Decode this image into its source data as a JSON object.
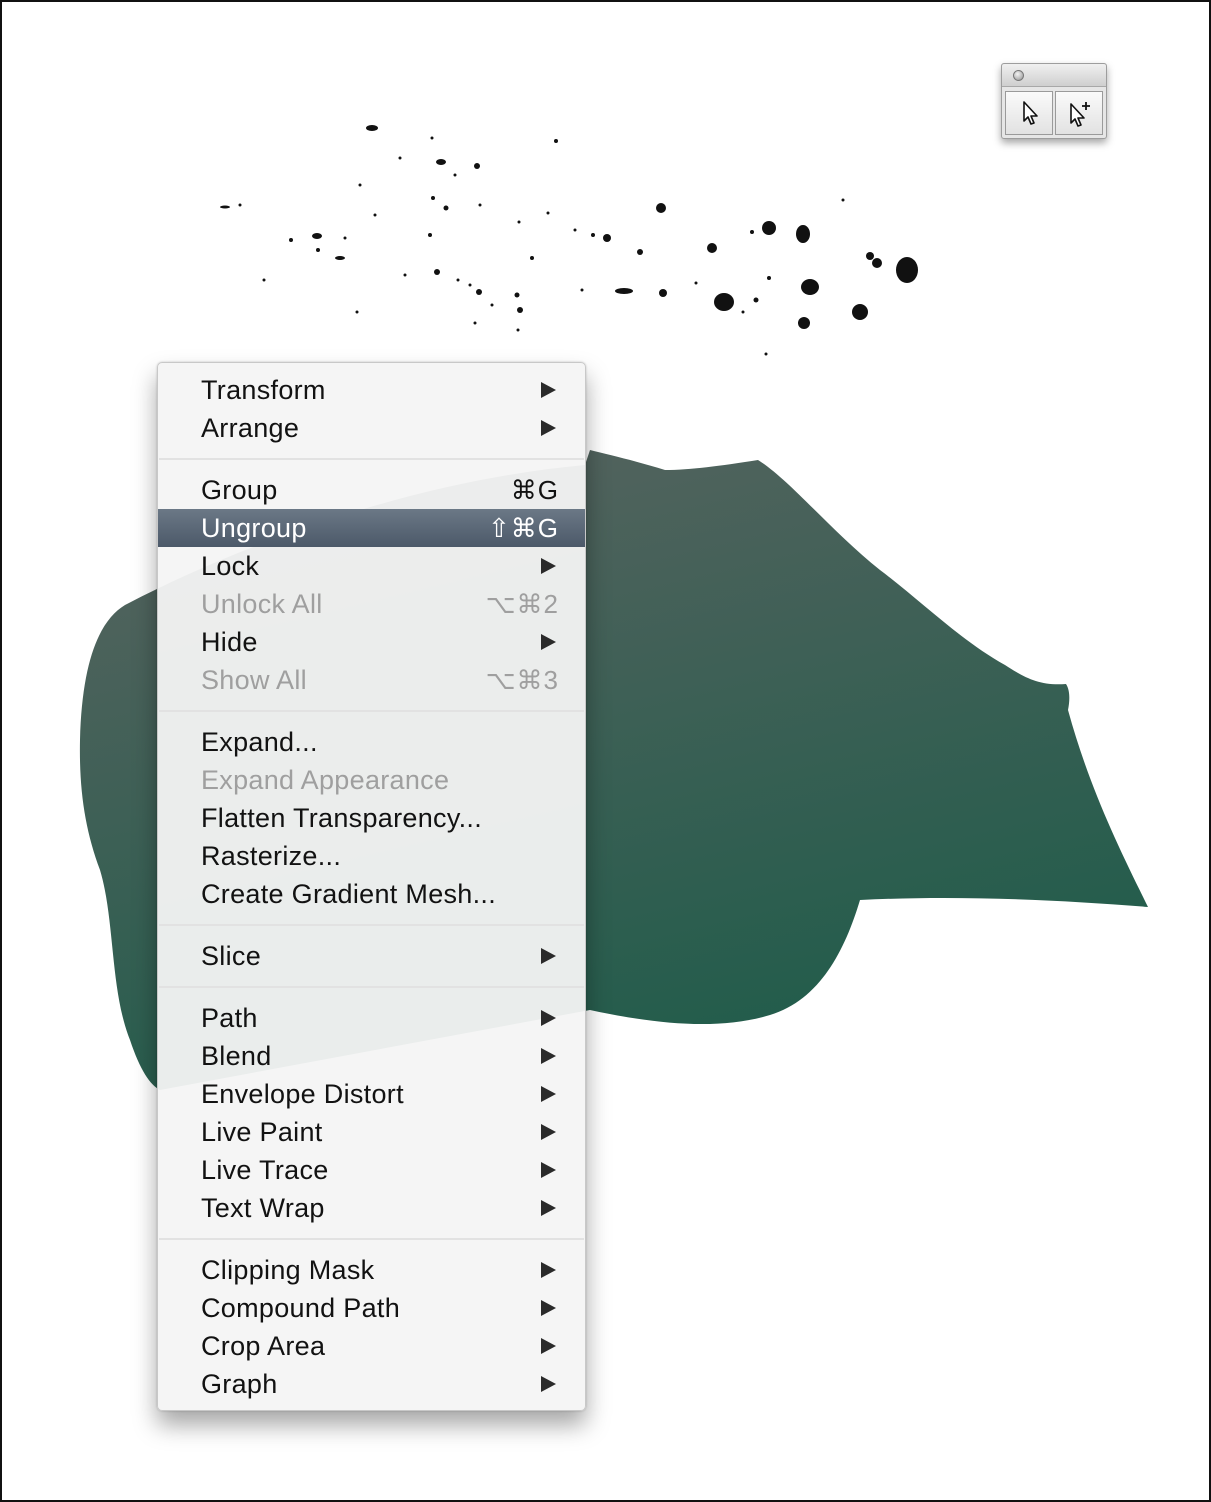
{
  "palette": {
    "tools": [
      {
        "icon": "direct-selection-arrow-icon"
      },
      {
        "icon": "group-selection-arrow-icon"
      }
    ]
  },
  "canvas": {
    "shape_colors": [
      "#4e6660",
      "#1f5c4a"
    ],
    "splatter_color": "#111111"
  },
  "menu": {
    "sections": [
      [
        {
          "label": "Transform",
          "submenu": true
        },
        {
          "label": "Arrange",
          "submenu": true
        }
      ],
      [
        {
          "label": "Group",
          "shortcut": "⌘G"
        },
        {
          "label": "Ungroup",
          "shortcut": "⇧⌘G",
          "selected": true
        },
        {
          "label": "Lock",
          "submenu": true
        },
        {
          "label": "Unlock All",
          "shortcut": "⌥⌘2",
          "disabled": true
        },
        {
          "label": "Hide",
          "submenu": true
        },
        {
          "label": "Show All",
          "shortcut": "⌥⌘3",
          "disabled": true
        }
      ],
      [
        {
          "label": "Expand..."
        },
        {
          "label": "Expand Appearance",
          "disabled": true
        },
        {
          "label": "Flatten Transparency..."
        },
        {
          "label": "Rasterize..."
        },
        {
          "label": "Create Gradient Mesh..."
        }
      ],
      [
        {
          "label": "Slice",
          "submenu": true
        }
      ],
      [
        {
          "label": "Path",
          "submenu": true
        },
        {
          "label": "Blend",
          "submenu": true
        },
        {
          "label": "Envelope Distort",
          "submenu": true
        },
        {
          "label": "Live Paint",
          "submenu": true
        },
        {
          "label": "Live Trace",
          "submenu": true
        },
        {
          "label": "Text Wrap",
          "submenu": true
        }
      ],
      [
        {
          "label": "Clipping Mask",
          "submenu": true
        },
        {
          "label": "Compound Path",
          "submenu": true
        },
        {
          "label": "Crop Area",
          "submenu": true
        },
        {
          "label": "Graph",
          "submenu": true
        }
      ]
    ]
  }
}
